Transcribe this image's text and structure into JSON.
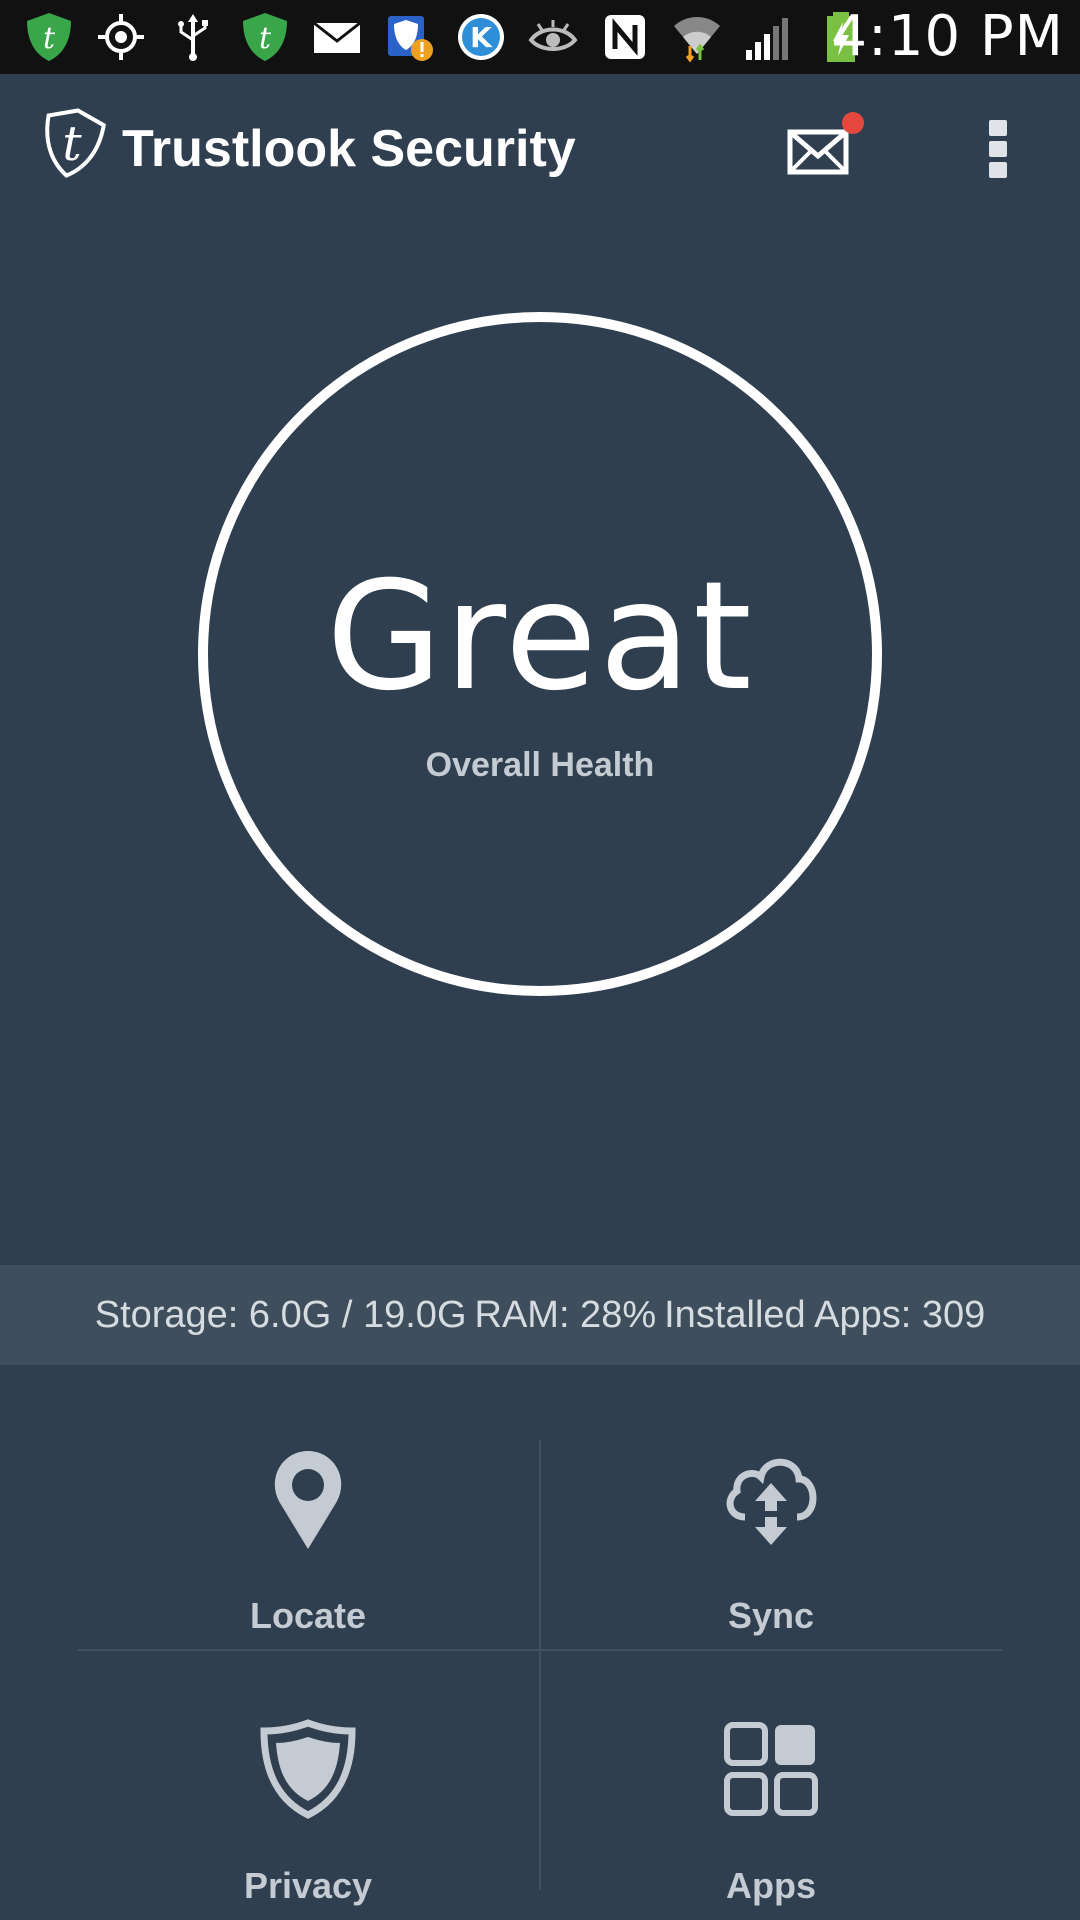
{
  "status_bar": {
    "time": "4:10 PM",
    "icons": [
      "trustlook-icon",
      "gps-icon",
      "usb-icon",
      "trustlook-icon",
      "email-icon",
      "shield-alert-icon",
      "k-app-icon",
      "eye-icon",
      "nfc-icon",
      "wifi-icon",
      "signal-icon",
      "battery-charging-icon"
    ]
  },
  "app_bar": {
    "title": "Trustlook Security",
    "logo_icon": "trustlook-shield-logo",
    "mail_icon": "envelope-icon",
    "menu_icon": "overflow-menu-icon"
  },
  "health": {
    "status": "Great",
    "label": "Overall Health"
  },
  "info": {
    "storage": "Storage: 6.0G / 19.0G",
    "ram": "RAM: 28%",
    "apps": "Installed Apps: 309"
  },
  "tiles": {
    "locate": {
      "label": "Locate",
      "icon": "map-pin-icon"
    },
    "sync": {
      "label": "Sync",
      "icon": "cloud-sync-icon"
    },
    "privacy": {
      "label": "Privacy",
      "icon": "shield-icon"
    },
    "apps": {
      "label": "Apps",
      "icon": "apps-grid-icon"
    }
  },
  "colors": {
    "background": "#2f3f4f",
    "status_bar": "#111111",
    "info_strip": "#3e4e5d",
    "badge": "#e5483f",
    "icon_gray": "#c4cbd2",
    "trustlook_green": "#3aa64a"
  }
}
